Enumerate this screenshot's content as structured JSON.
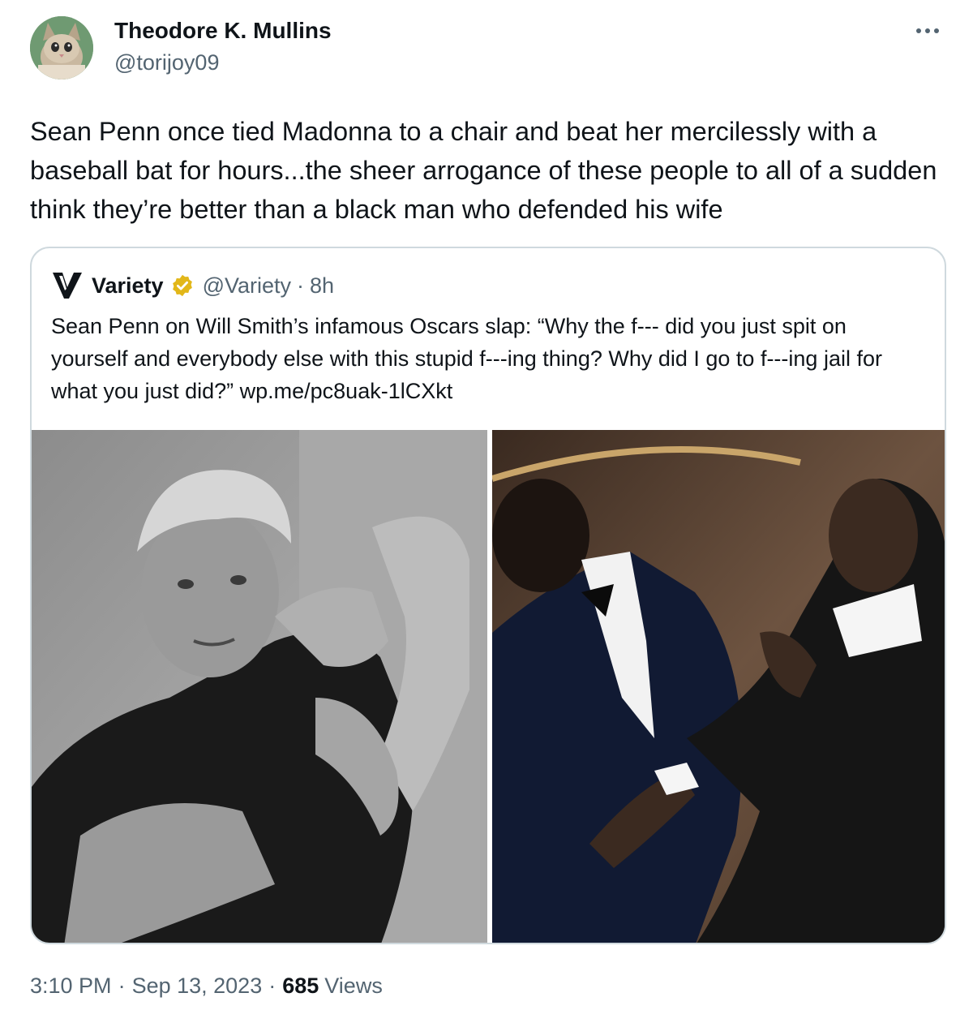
{
  "author": {
    "name": "Theodore K. Mullins",
    "handle": "@torijoy09"
  },
  "tweet": {
    "text": "Sean Penn once tied Madonna to a chair and beat her mercilessly with a baseball bat for hours...the sheer arrogance of these people to all of a sudden think they’re better than a black man who defended his wife"
  },
  "quote": {
    "name": "Variety",
    "handle": "@Variety",
    "separator": "·",
    "time": "8h",
    "text": "Sean Penn on Will Smith’s infamous Oscars slap: “Why the f--- did you just spit on yourself and everybody else with this stupid f---ing thing? Why did I go to f---ing jail for what you just did?” wp.me/pc8uak-1lCXkt",
    "verified_badge_color": "#e2b719"
  },
  "footer": {
    "time": "3:10 PM",
    "sep1": "·",
    "date": "Sep 13, 2023",
    "sep2": "·",
    "views_count": "685",
    "views_label": "Views"
  },
  "colors": {
    "text": "#0f1419",
    "secondary": "#536471",
    "border": "#cfd9de"
  }
}
